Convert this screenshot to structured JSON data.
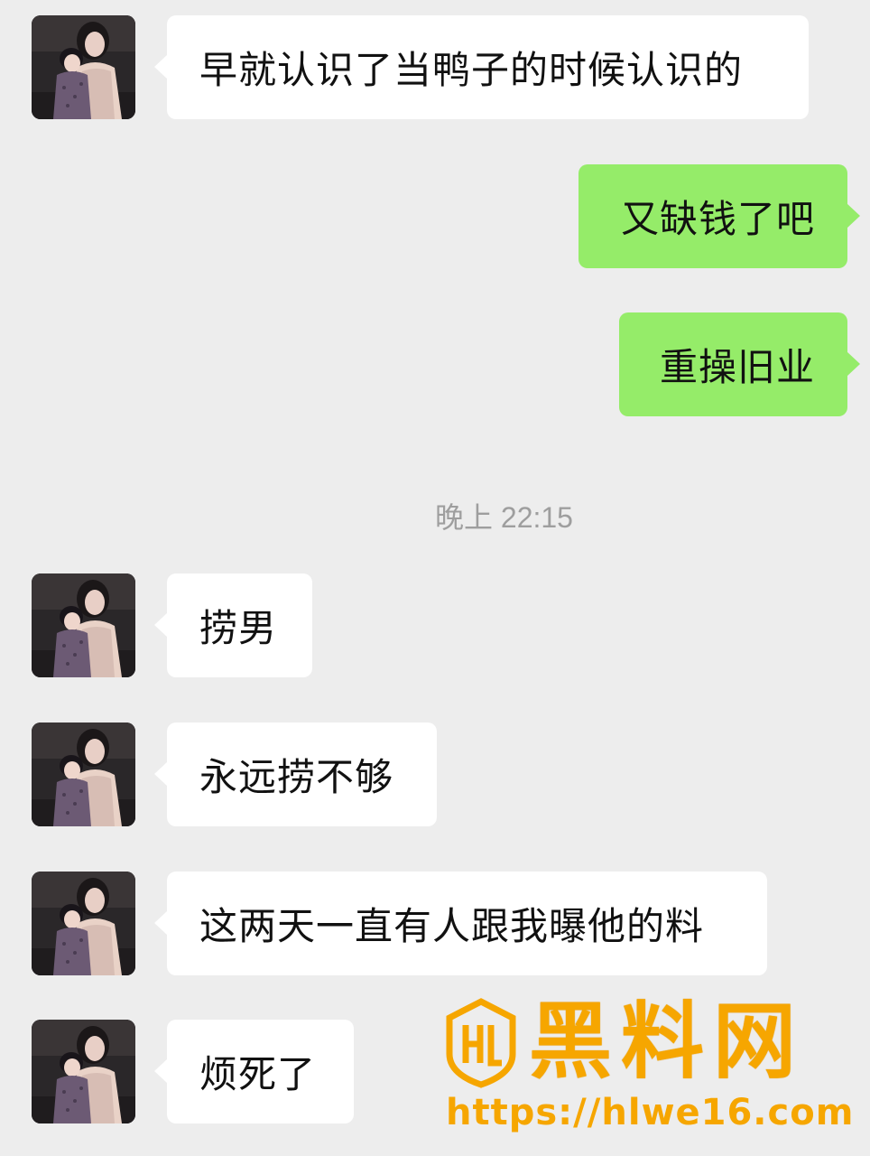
{
  "conversation": {
    "messages": [
      {
        "side": "in",
        "text": "早就认识了当鸭子的时候认识的"
      },
      {
        "side": "out",
        "text": "又缺钱了吧"
      },
      {
        "side": "out",
        "text": "重操旧业"
      },
      {
        "side": "in",
        "text": "捞男"
      },
      {
        "side": "in",
        "text": "永远捞不够"
      },
      {
        "side": "in",
        "text": "这两天一直有人跟我曝他的料"
      },
      {
        "side": "in",
        "text": "烦死了"
      }
    ],
    "timestamp": "晚上 22:15",
    "contact_avatar_icon": "contact-photo-avatar"
  },
  "watermark": {
    "title": "黑料网",
    "url": "https://hlwe16.com",
    "logo_icon": "hl-shield-logo",
    "color": "#f6a600"
  },
  "colors": {
    "background": "#ededed",
    "incoming_bubble": "#ffffff",
    "outgoing_bubble": "#95ec69",
    "timestamp": "#9e9e9e"
  }
}
